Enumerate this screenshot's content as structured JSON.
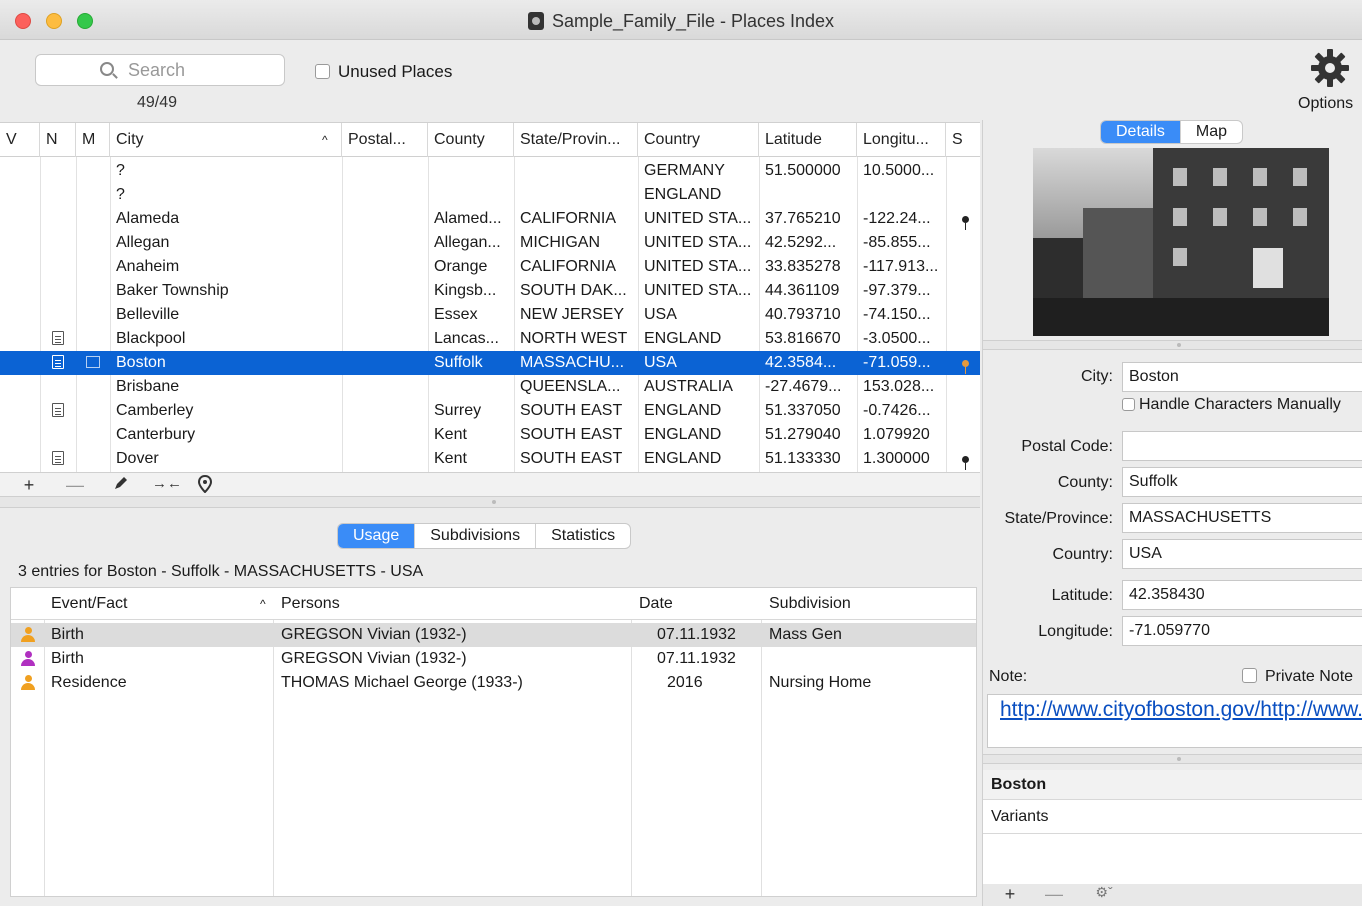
{
  "window": {
    "title": "Sample_Family_File - Places Index"
  },
  "toolbar": {
    "search_placeholder": "Search",
    "count": "49/49",
    "unused_places_label": "Unused Places",
    "options_label": "Options"
  },
  "places": {
    "columns": [
      "V",
      "N",
      "M",
      "City",
      "Postal...",
      "County",
      "State/Provin...",
      "Country",
      "Latitude",
      "Longitu...",
      "S"
    ],
    "rows": [
      {
        "city": "?",
        "postal": "",
        "county": "",
        "state": "",
        "country": "GERMANY",
        "lat": "51.500000",
        "lon": "10.5000..."
      },
      {
        "city": "?",
        "postal": "",
        "county": "",
        "state": "",
        "country": "ENGLAND",
        "lat": "",
        "lon": ""
      },
      {
        "city": "Alameda",
        "postal": "",
        "county": "Alamed...",
        "state": "CALIFORNIA",
        "country": "UNITED STA...",
        "lat": "37.765210",
        "lon": "-122.24..."
      },
      {
        "city": "Allegan",
        "postal": "",
        "county": "Allegan...",
        "state": "MICHIGAN",
        "country": "UNITED STA...",
        "lat": "42.5292...",
        "lon": "-85.855..."
      },
      {
        "city": "Anaheim",
        "postal": "",
        "county": "Orange",
        "state": "CALIFORNIA",
        "country": "UNITED STA...",
        "lat": "33.835278",
        "lon": "-117.913..."
      },
      {
        "city": "Baker Township",
        "postal": "",
        "county": "Kingsb...",
        "state": "SOUTH DAK...",
        "country": "UNITED STA...",
        "lat": "44.361109",
        "lon": "-97.379..."
      },
      {
        "city": "Belleville",
        "postal": "",
        "county": "Essex",
        "state": "NEW JERSEY",
        "country": "USA",
        "lat": "40.793710",
        "lon": "-74.150..."
      },
      {
        "city": "Blackpool",
        "postal": "",
        "county": "Lancas...",
        "state": "NORTH WEST",
        "country": "ENGLAND",
        "lat": "53.816670",
        "lon": "-3.0500..."
      },
      {
        "city": "Boston",
        "postal": "",
        "county": "Suffolk",
        "state": "MASSACHU...",
        "country": "USA",
        "lat": "42.3584...",
        "lon": "-71.059..."
      },
      {
        "city": "Brisbane",
        "postal": "",
        "county": "",
        "state": "QUEENSLA...",
        "country": "AUSTRALIA",
        "lat": "-27.4679...",
        "lon": "153.028..."
      },
      {
        "city": "Camberley",
        "postal": "",
        "county": "Surrey",
        "state": "SOUTH EAST",
        "country": "ENGLAND",
        "lat": "51.337050",
        "lon": "-0.7426..."
      },
      {
        "city": "Canterbury",
        "postal": "",
        "county": "Kent",
        "state": "SOUTH EAST",
        "country": "ENGLAND",
        "lat": "51.279040",
        "lon": "1.079920"
      },
      {
        "city": "Dover",
        "postal": "",
        "county": "Kent",
        "state": "SOUTH EAST",
        "country": "ENGLAND",
        "lat": "51.133330",
        "lon": "1.300000"
      }
    ],
    "bar": {
      "add": "+",
      "remove": "—",
      "move": "→←"
    }
  },
  "tabs": {
    "usage": "Usage",
    "subdivisions": "Subdivisions",
    "statistics": "Statistics"
  },
  "usage": {
    "summary": "3 entries for Boston - Suffolk - MASSACHUSETTS - USA",
    "columns": [
      "Event/Fact",
      "Persons",
      "Date",
      "Subdivision"
    ],
    "rows": [
      {
        "event": "Birth",
        "person": "GREGSON Vivian (1932-)",
        "date": "07.11.1932",
        "subdivision": "Mass Gen",
        "icon_color": "#f0a020"
      },
      {
        "event": "Birth",
        "person": "GREGSON Vivian (1932-)",
        "date": "07.11.1932",
        "subdivision": "",
        "icon_color": "#b030c0"
      },
      {
        "event": "Residence",
        "person": "THOMAS Michael George (1933-)",
        "date": "2016",
        "subdivision": "Nursing Home",
        "icon_color": "#f0a020"
      }
    ]
  },
  "right": {
    "tab_details": "Details",
    "tab_map": "Map",
    "city_label": "City:",
    "city": "Boston",
    "handle_chars_label": "Handle Characters Manually",
    "postal_label": "Postal Code:",
    "postal": "",
    "county_label": "County:",
    "county": "Suffolk",
    "state_label": "State/Province:",
    "state": "MASSACHUSETTS",
    "country_label": "Country:",
    "country": "USA",
    "latitude_label": "Latitude:",
    "latitude": "42.358430",
    "longitude_label": "Longitude:",
    "longitude": "-71.059770",
    "note_label": "Note:",
    "private_note_label": "Private Note",
    "note_text": "http://www.cityofboston.gov/http://www.cityofboston.gov/",
    "place_header": "Boston",
    "variants_label": "Variants",
    "bar": {
      "add": "+",
      "remove": "—"
    }
  }
}
